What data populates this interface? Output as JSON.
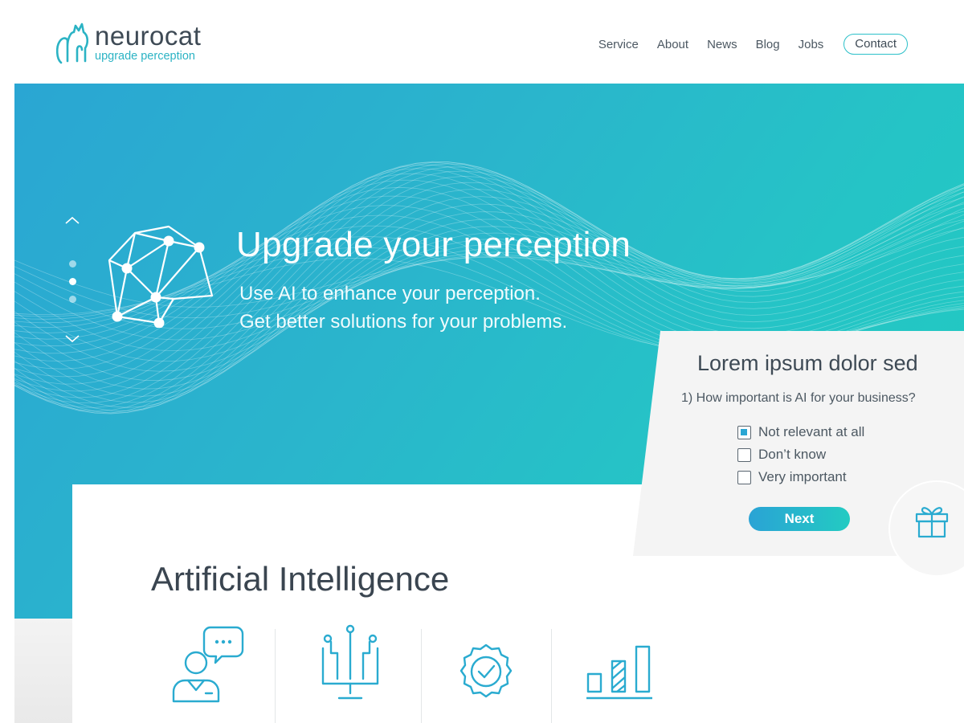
{
  "brand": {
    "name": "neurocat",
    "tagline": "upgrade perception"
  },
  "nav": {
    "items": [
      "Service",
      "About",
      "News",
      "Blog",
      "Jobs"
    ],
    "contact_label": "Contact"
  },
  "hero": {
    "title": "Upgrade your perception",
    "subtitle_line1": "Use AI to enhance your perception.",
    "subtitle_line2": "Get better solutions for your problems.",
    "slider": {
      "dots": 3,
      "active_index": 1
    }
  },
  "survey": {
    "title": "Lorem ipsum dolor sed",
    "question": "1) How important is AI for your business?",
    "options": [
      {
        "label": "Not relevant at all",
        "checked": true
      },
      {
        "label": "Don’t know",
        "checked": false
      },
      {
        "label": "Very important",
        "checked": false
      }
    ],
    "next_label": "Next"
  },
  "section": {
    "title": "Artificial Intelligence",
    "features": [
      {
        "icon": "consultant-chat-icon"
      },
      {
        "icon": "circuit-monitor-icon"
      },
      {
        "icon": "verified-badge-icon"
      },
      {
        "icon": "bar-chart-icon"
      }
    ]
  },
  "colors": {
    "accent_blue": "#2aa6d3",
    "accent_teal": "#20cbc0",
    "text_dark": "#3e4a55"
  }
}
